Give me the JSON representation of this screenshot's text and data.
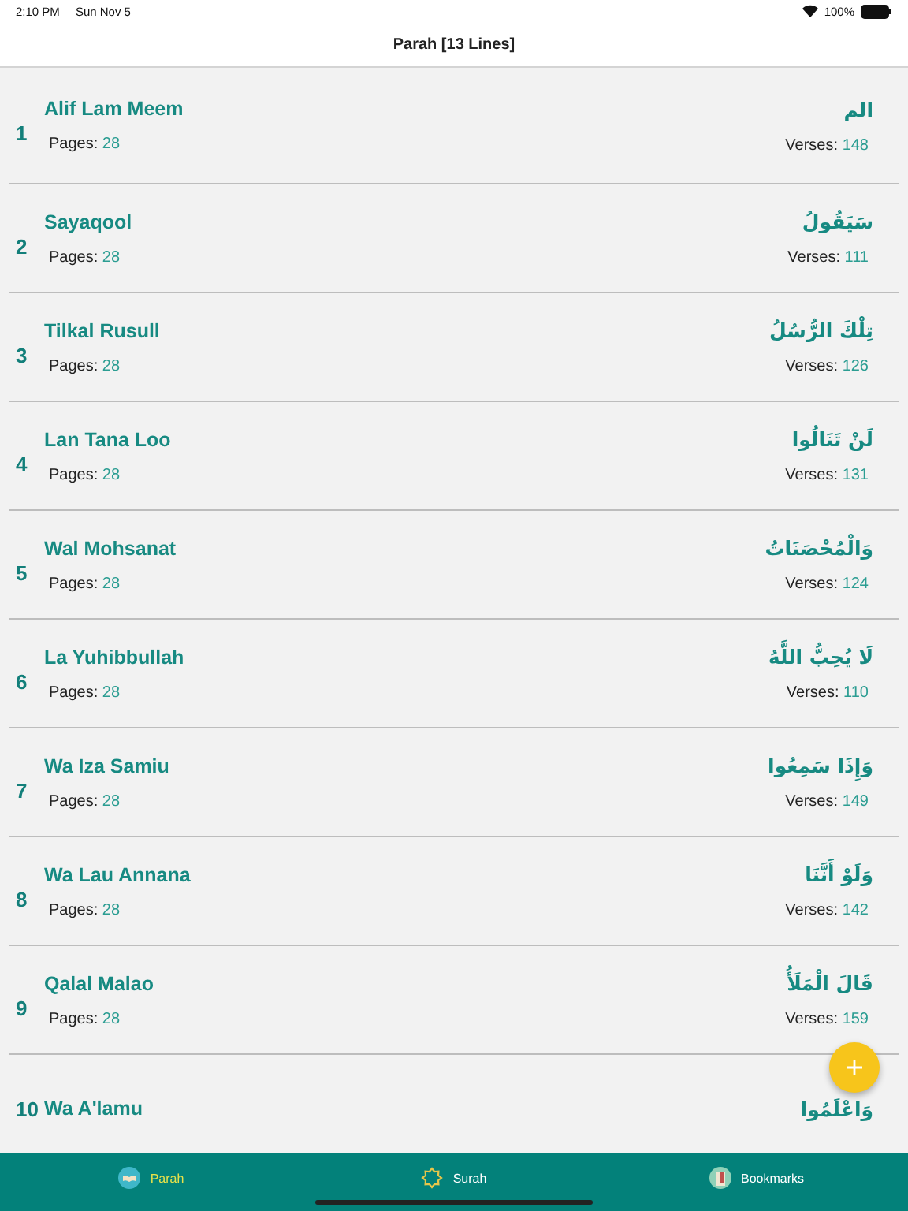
{
  "status_bar": {
    "time": "2:10 PM",
    "date": "Sun Nov 5",
    "battery": "100%"
  },
  "title": "Parah [13 Lines]",
  "rows": [
    {
      "number": "1",
      "name": "Alif Lam Meem",
      "arabic": "الم",
      "pages_label": "Pages:",
      "pages": "28",
      "verses_label": "Verses:",
      "verses": "148"
    },
    {
      "number": "2",
      "name": "Sayaqool",
      "arabic": "سَيَقُولُ",
      "pages_label": "Pages:",
      "pages": "28",
      "verses_label": "Verses:",
      "verses": "111"
    },
    {
      "number": "3",
      "name": "Tilkal Rusull",
      "arabic": "تِلْكَ الرُّسُلُ",
      "pages_label": "Pages:",
      "pages": "28",
      "verses_label": "Verses:",
      "verses": "126"
    },
    {
      "number": "4",
      "name": "Lan Tana Loo",
      "arabic": "لَنْ تَنَالُوا",
      "pages_label": "Pages:",
      "pages": "28",
      "verses_label": "Verses:",
      "verses": "131"
    },
    {
      "number": "5",
      "name": "Wal Mohsanat",
      "arabic": "وَالْمُحْصَنَاتُ",
      "pages_label": "Pages:",
      "pages": "28",
      "verses_label": "Verses:",
      "verses": "124"
    },
    {
      "number": "6",
      "name": "La Yuhibbullah",
      "arabic": "لَا يُحِبُّ اللَّهُ",
      "pages_label": "Pages:",
      "pages": "28",
      "verses_label": "Verses:",
      "verses": "110"
    },
    {
      "number": "7",
      "name": "Wa Iza Samiu",
      "arabic": "وَإِذَا سَمِعُوا",
      "pages_label": "Pages:",
      "pages": "28",
      "verses_label": "Verses:",
      "verses": "149"
    },
    {
      "number": "8",
      "name": "Wa Lau Annana",
      "arabic": "وَلَوْ أَنَّنَا",
      "pages_label": "Pages:",
      "pages": "28",
      "verses_label": "Verses:",
      "verses": "142"
    },
    {
      "number": "9",
      "name": "Qalal Malao",
      "arabic": "قَالَ الْمَلَأُ",
      "pages_label": "Pages:",
      "pages": "28",
      "verses_label": "Verses:",
      "verses": "159"
    },
    {
      "number": "10",
      "name": "Wa A'lamu",
      "arabic": "وَاعْلَمُوا"
    }
  ],
  "tabs": [
    {
      "label": "Parah",
      "selected": true
    },
    {
      "label": "Surah",
      "selected": false
    },
    {
      "label": "Bookmarks",
      "selected": false
    }
  ]
}
